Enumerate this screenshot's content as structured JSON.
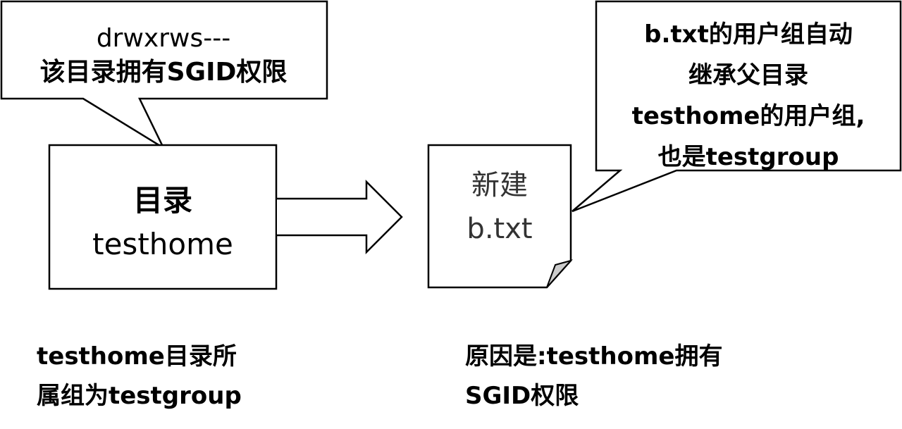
{
  "callout_left": {
    "line1": "drwxrws---",
    "line2": "该目录拥有SGID权限"
  },
  "callout_right": {
    "line1": "b.txt的用户组自动",
    "line2": "继承父目录",
    "line3": "testhome的用户组,",
    "line4": "也是testgroup"
  },
  "directory_box": {
    "line1": "目录",
    "line2": "testhome"
  },
  "file_shape": {
    "line1": "新建",
    "line2": "b.txt"
  },
  "note_left": {
    "line1": "testhome目录所",
    "line2": "属组为testgroup"
  },
  "note_right": {
    "line1": "原因是:testhome拥有",
    "line2": "SGID权限"
  },
  "colors": {
    "stroke": "#000000",
    "fill": "#ffffff",
    "page_fold": "#cccccc"
  }
}
